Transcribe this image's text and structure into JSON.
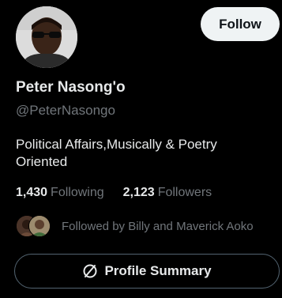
{
  "profile": {
    "name": "Peter Nasong'o",
    "handle": "@PeterNasongo",
    "bio": "Political Affairs,Musically & Poetry Oriented"
  },
  "actions": {
    "follow_label": "Follow",
    "profile_summary_label": "Profile Summary"
  },
  "stats": {
    "following_count": "1,430",
    "following_label": "Following",
    "followers_count": "2,123",
    "followers_label": "Followers"
  },
  "followed_by": {
    "text": "Followed by Billy and Maverick Aoko"
  },
  "colors": {
    "background": "#000000",
    "primary_text": "#e7e9ea",
    "secondary_text": "#71767b",
    "follow_button_bg": "#eff3f4",
    "outline_border": "#536471"
  },
  "icons": {
    "summary": "summary-icon"
  }
}
